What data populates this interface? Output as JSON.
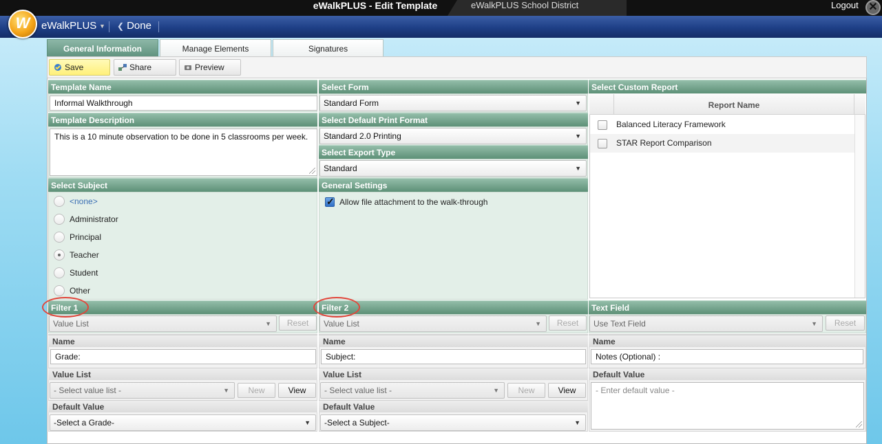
{
  "window": {
    "title": "eWalkPLUS - Edit Template",
    "district": "eWalkPLUS School District",
    "logout": "Logout",
    "close_glyph": "✕"
  },
  "nav": {
    "logo_letter": "W",
    "brand": "eWalkPLUS",
    "brand_caret": "▼",
    "done": "Done",
    "done_glyph": "❮"
  },
  "tabs": [
    {
      "label": "General Information",
      "active": true
    },
    {
      "label": "Manage Elements",
      "active": false
    },
    {
      "label": "Signatures",
      "active": false
    }
  ],
  "toolbar": {
    "save": "Save",
    "share": "Share",
    "preview": "Preview"
  },
  "template": {
    "name_header": "Template Name",
    "name_value": "Informal Walkthrough",
    "desc_header": "Template Description",
    "desc_value": "This is a 10 minute observation to be done in 5 classrooms per week."
  },
  "form": {
    "select_form_header": "Select Form",
    "select_form_value": "Standard Form",
    "print_header": "Select Default Print Format",
    "print_value": "Standard 2.0 Printing",
    "export_header": "Select Export Type",
    "export_value": "Standard"
  },
  "report": {
    "header": "Select Custom Report",
    "column": "Report Name",
    "rows": [
      {
        "name": "Balanced Literacy Framework",
        "checked": false
      },
      {
        "name": "STAR Report Comparison",
        "checked": false
      }
    ]
  },
  "subject": {
    "header": "Select Subject",
    "options": [
      {
        "label": "<none>",
        "selected": false
      },
      {
        "label": "Administrator",
        "selected": false
      },
      {
        "label": "Principal",
        "selected": false
      },
      {
        "label": "Teacher",
        "selected": true
      },
      {
        "label": "Student",
        "selected": false
      },
      {
        "label": "Other",
        "selected": false
      }
    ]
  },
  "settings": {
    "header": "General Settings",
    "attachment_label": "Allow file attachment to the walk-through",
    "attachment_checked": true
  },
  "filter1": {
    "header": "Filter 1",
    "type": "Value List",
    "reset": "Reset",
    "name_label": "Name",
    "name_value": "Grade:",
    "value_list_label": "Value List",
    "value_list_value": "- Select value list -",
    "new": "New",
    "view": "View",
    "default_label": "Default Value",
    "default_value": "-Select a Grade-"
  },
  "filter2": {
    "header": "Filter 2",
    "type": "Value List",
    "reset": "Reset",
    "name_label": "Name",
    "name_value": "Subject:",
    "value_list_label": "Value List",
    "value_list_value": "- Select value list -",
    "new": "New",
    "view": "View",
    "default_label": "Default Value",
    "default_value": "-Select a Subject-"
  },
  "textfield": {
    "header": "Text Field",
    "type": "Use Text Field",
    "reset": "Reset",
    "name_label": "Name",
    "name_value": "Notes (Optional) :",
    "default_label": "Default Value",
    "default_placeholder": "- Enter default value -"
  },
  "colors": {
    "header_green": "#5d9077",
    "zone_green": "#e3efe8",
    "nav_blue": "#1e3f86",
    "highlight_red": "#e2453a",
    "save_yellow": "#fff07a"
  },
  "glyphs": {
    "caret": "▼"
  }
}
